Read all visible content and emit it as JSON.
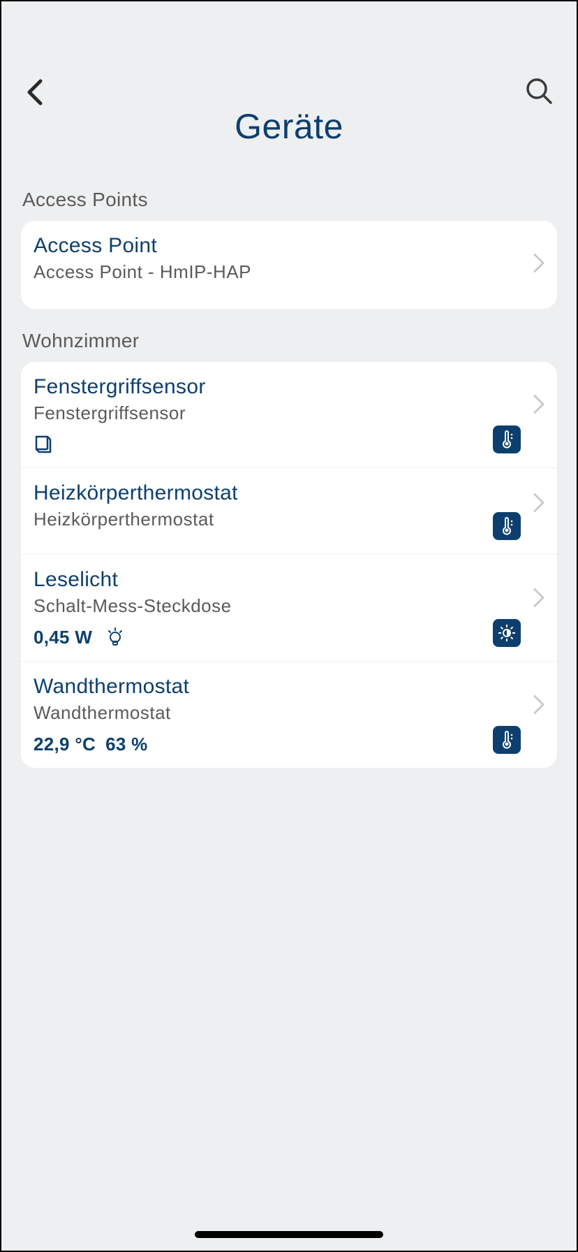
{
  "header": {
    "title": "Geräte"
  },
  "sections": [
    {
      "header": "Access Points",
      "items": [
        {
          "title": "Access Point",
          "subtitle": "Access Point - HmIP-HAP"
        }
      ]
    },
    {
      "header": "Wohnzimmer",
      "items": [
        {
          "title": "Fenstergriffsensor",
          "subtitle": "Fenstergriffsensor",
          "badge_icon": "thermometer",
          "left_icon": "window"
        },
        {
          "title": "Heizkörperthermostat",
          "subtitle": "Heizkörperthermostat",
          "badge_icon": "thermometer"
        },
        {
          "title": "Leselicht",
          "subtitle": "Schalt-Mess-Steckdose",
          "value": "0,45 W",
          "left_icon": "bulb",
          "badge_icon": "brightness"
        },
        {
          "title": "Wandthermostat",
          "subtitle": "Wandthermostat",
          "value": "22,9 °C",
          "value2": "63 %",
          "badge_icon": "thermometer"
        }
      ]
    }
  ]
}
